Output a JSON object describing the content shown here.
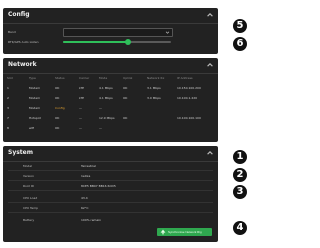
{
  "config": {
    "title": "Config",
    "fields": [
      {
        "label": "Band",
        "value": ""
      },
      {
        "label": "RTK/GPS Auto Listen",
        "value": 0.6
      }
    ]
  },
  "network": {
    "title": "Network",
    "columns": [
      "Slot",
      "Type",
      "Status",
      "Carrier",
      "Mode",
      "Uplink",
      "Network Rx",
      "IP Address"
    ],
    "rows": [
      [
        "1",
        "Modem",
        "OK",
        "LTE",
        "4.1 Mbps",
        "OK",
        "3.1 Mbps",
        "10.150.100.200"
      ],
      [
        "2",
        "Modem",
        "OK",
        "LTE",
        "4.1 Mbps",
        "OK",
        "3.0 Mbps",
        "10.100.1.220"
      ],
      [
        "3",
        "Modem",
        "Config",
        "—",
        "—",
        "",
        "",
        ""
      ],
      [
        "7",
        "Hotspot",
        "OK",
        "—",
        "12.9 Mbps",
        "OK",
        "",
        "10.100.100.100"
      ],
      [
        "8",
        "wifi",
        "OK",
        "—",
        "—",
        "",
        "",
        ""
      ]
    ]
  },
  "system": {
    "title": "System",
    "fields": [
      {
        "label": "Model",
        "value": "Terrestrial"
      },
      {
        "label": "Version",
        "value": "1e0xa"
      },
      {
        "label": "Root ID",
        "value": "8CE5 BB07 BB16 6CD5"
      },
      {
        "label": "CPU Load",
        "value": "43.4"
      },
      {
        "label": "CPU Temp",
        "value": "62°C"
      },
      {
        "label": "Battery",
        "value": "100% remain"
      }
    ],
    "save_label": "Synchronise Network Rig"
  },
  "callouts": [
    "5",
    "6",
    "1",
    "2",
    "3",
    "4"
  ],
  "colors": {
    "panel": "#222222",
    "accent": "#2fbf5a",
    "callout": "#111111"
  }
}
